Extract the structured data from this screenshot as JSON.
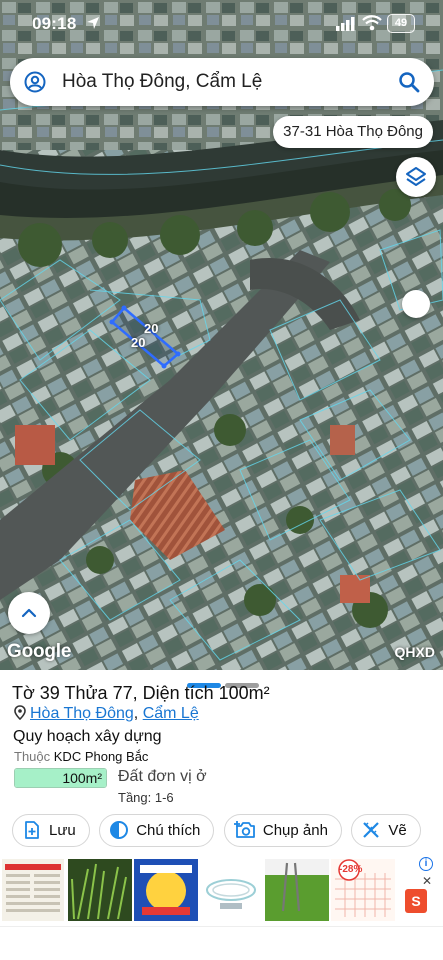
{
  "status_bar": {
    "time": "09:18",
    "battery": "49"
  },
  "search": {
    "query": "Hòa Thọ Đông, Cẩm Lệ"
  },
  "map": {
    "address_chip": "37-31 Hòa Thọ Đông",
    "parcel_edge_labels": [
      "20",
      "20"
    ],
    "logo": "Google",
    "overlay_badge": "QHXD"
  },
  "sheet": {
    "title": "Tờ 39 Thửa 77, Diện tích 100m²",
    "location": {
      "ward": "Hòa Thọ Đông",
      "separator": ",",
      "district": "Cẩm Lệ"
    },
    "planning_title": "Quy hoạch xây dựng",
    "belongs_prefix": "Thuộc",
    "belongs_value": "KDC Phong Bắc",
    "area_value": "100m²",
    "area_fill_fraction": 1.0,
    "land_type": "Đất đơn vị ở",
    "floors": "Tầng: 1-6",
    "actions": [
      {
        "label": "Lưu",
        "icon": "add-note-icon"
      },
      {
        "label": "Chú thích",
        "icon": "contrast-icon"
      },
      {
        "label": "Chụp ảnh",
        "icon": "camera-add-icon"
      },
      {
        "label": "Vẽ",
        "icon": "draw-ruler-icon"
      }
    ]
  },
  "ads": {
    "badge": "-28%"
  },
  "colors": {
    "accent": "#1e88e5",
    "link": "#1976d2",
    "area_fill": "#a6f0c8"
  }
}
